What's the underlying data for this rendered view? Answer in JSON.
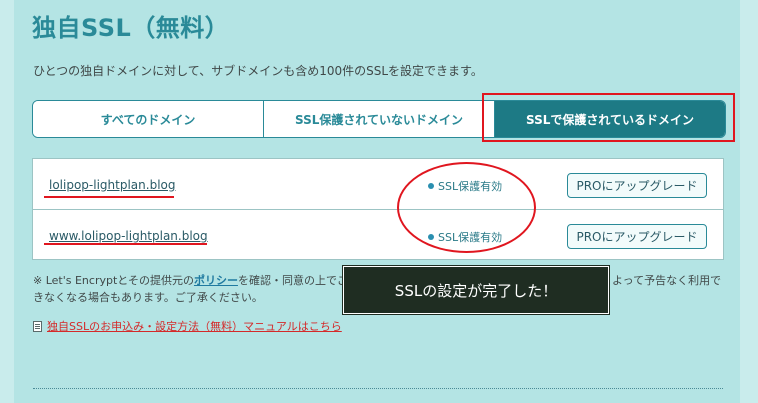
{
  "header": {
    "title": "独自SSL（無料）",
    "description": "ひとつの独自ドメインに対して、サブドメインも含め100件のSSLを設定できます。"
  },
  "tabs": [
    {
      "label": "すべてのドメイン",
      "active": false
    },
    {
      "label": "SSL保護されていないドメイン",
      "active": false
    },
    {
      "label": "SSLで保護されているドメイン",
      "active": true
    }
  ],
  "domains": [
    {
      "name": "lolipop-lightplan.blog",
      "status": "SSL保護有効",
      "button": "PROにアップグレード"
    },
    {
      "name": "www.lolipop-lightplan.blog",
      "status": "SSL保護有効",
      "button": "PROにアップグレード"
    }
  ],
  "note": {
    "prefix": "※ Let's Encryptとその提供元の",
    "policy_link": "ポリシー",
    "middle": "を確認・同意の上でご",
    "suffix": "よって予告なく利用で",
    "line2": "きなくなる場合もあります。ご了承ください。"
  },
  "manual_link": "独自SSLのお申込み・設定方法（無料）マニュアルはこちら",
  "toast": "SSLの設定が完了した！",
  "colors": {
    "accent": "#2a8a98",
    "active_tab": "#1d7a85",
    "annotation_red": "#e0161f",
    "toast_bg": "#1f2d22"
  }
}
